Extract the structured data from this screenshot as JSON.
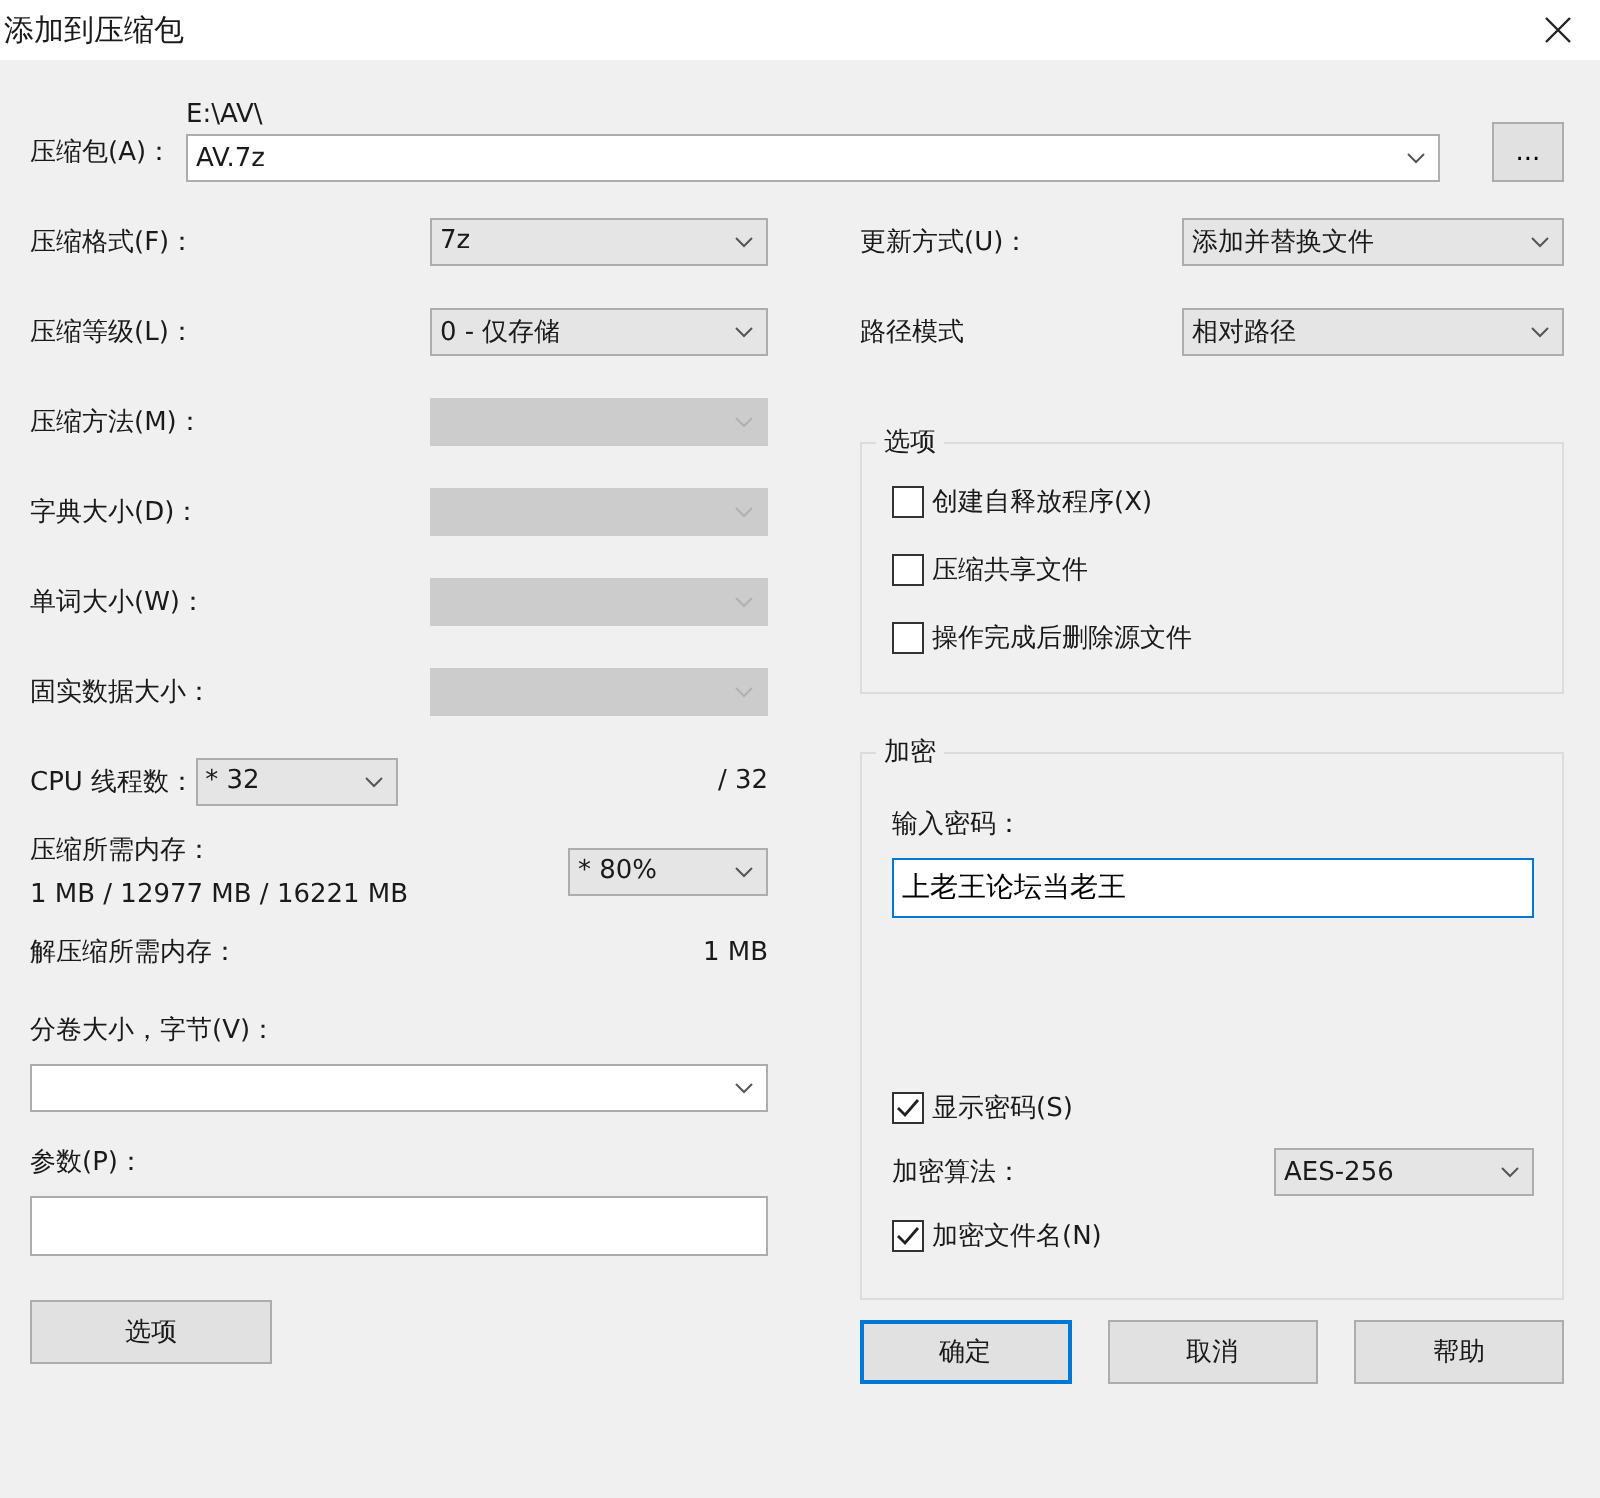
{
  "window": {
    "title": "添加到压缩包"
  },
  "archive": {
    "label": "压缩包(A)：",
    "path": "E:\\AV\\",
    "value": "AV.7z",
    "browse": "..."
  },
  "left_fields": [
    {
      "label": "压缩格式(F)：",
      "value": "7z",
      "disabled": false
    },
    {
      "label": "压缩等级(L)：",
      "value": "0 - 仅存储",
      "disabled": false
    },
    {
      "label": "压缩方法(M)：",
      "disabled": true
    },
    {
      "label": "字典大小(D)：",
      "disabled": true
    },
    {
      "label": "单词大小(W)：",
      "disabled": true
    },
    {
      "label": "固实数据大小：",
      "disabled": true
    },
    {
      "label": "CPU 线程数：",
      "value": "* 32",
      "disabled": false,
      "total": "/ 32"
    }
  ],
  "memory": {
    "label": "压缩所需内存：",
    "usage": "1 MB / 12977 MB / 16221 MB",
    "value": "* 80%"
  },
  "decompress_memory": {
    "label": "解压缩所需内存：",
    "value": "1 MB"
  },
  "volume": {
    "label": "分卷大小，字节(V)："
  },
  "parameters": {
    "label": "参数(P)："
  },
  "options_button": "选项",
  "right_fields": [
    {
      "label": "更新方式(U)：",
      "value": "添加并替换文件"
    },
    {
      "label": "路径模式",
      "value": "相对路径"
    }
  ],
  "options_group": {
    "title": "选项",
    "items": [
      {
        "label": "创建自释放程序(X)",
        "checked": false
      },
      {
        "label": "压缩共享文件",
        "checked": false
      },
      {
        "label": "操作完成后删除源文件",
        "checked": false
      }
    ]
  },
  "encryption": {
    "title": "加密",
    "password_label": "输入密码：",
    "password": "上老王论坛当老王",
    "show_password": {
      "label": "显示密码(S)",
      "checked": true
    },
    "method_label": "加密算法：",
    "method": "AES-256",
    "encrypt_names": {
      "label": "加密文件名(N)",
      "checked": true
    }
  },
  "buttons": [
    {
      "label": "确定",
      "default": true
    },
    {
      "label": "取消",
      "default": false
    },
    {
      "label": "帮助",
      "default": false
    }
  ]
}
